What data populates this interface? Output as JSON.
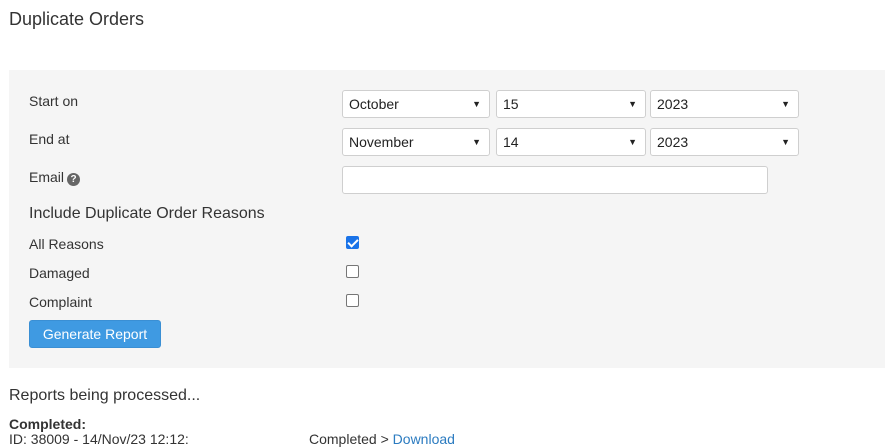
{
  "page": {
    "title": "Duplicate Orders"
  },
  "form": {
    "start_label": "Start on",
    "start": {
      "month": "October",
      "day": "15",
      "year": "2023"
    },
    "end_label": "End at",
    "end": {
      "month": "November",
      "day": "14",
      "year": "2023"
    },
    "email_label": "Email",
    "email_value": "",
    "help_glyph": "?",
    "reasons_heading": "Include Duplicate Order Reasons",
    "reasons": [
      {
        "label": "All Reasons",
        "checked": true
      },
      {
        "label": "Damaged",
        "checked": false
      },
      {
        "label": "Complaint",
        "checked": false
      }
    ],
    "generate_label": "Generate Report"
  },
  "reports": {
    "heading": "Reports being processed...",
    "completed_label": "Completed:",
    "items": [
      {
        "id_text": "ID: 38009 - 14/Nov/23 12:12:",
        "status_text": "Completed >",
        "link_text": "Download"
      }
    ]
  },
  "colors": {
    "accent": "#3f9ae2",
    "link": "#2b7bc0",
    "panel_bg": "#f5f5f5"
  },
  "icons": {
    "help": "question-circle-icon",
    "select_caret": "caret-down-icon"
  }
}
